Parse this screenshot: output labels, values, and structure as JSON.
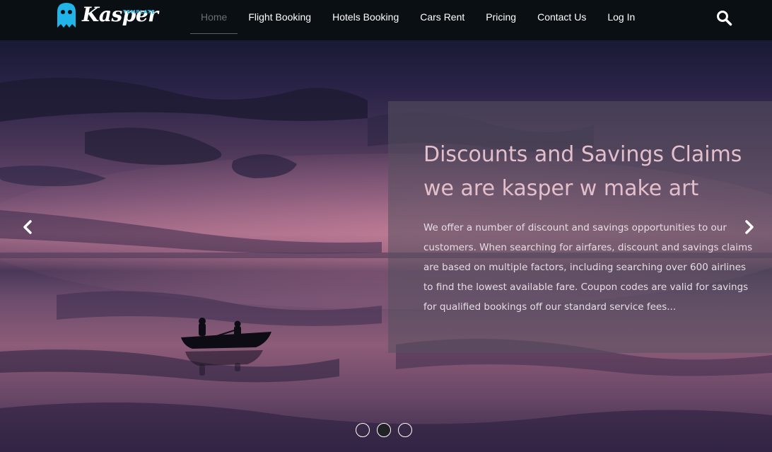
{
  "logo": {
    "wordmark": "Kasper",
    "tagline": "TEMPLATE",
    "ghost_icon": "ghost-icon",
    "accent": "#21b4e8"
  },
  "nav": {
    "items": [
      {
        "label": "Home",
        "active": true
      },
      {
        "label": "Flight Booking"
      },
      {
        "label": "Hotels Booking"
      },
      {
        "label": "Cars Rent"
      },
      {
        "label": "Pricing"
      },
      {
        "label": "Contact Us"
      },
      {
        "label": "Log In"
      }
    ],
    "search_icon": "search-icon"
  },
  "hero": {
    "title_line1": "Discounts and Savings Claims",
    "title_line2": "we are kasper w make art",
    "text": "We offer a number of discount and savings opportunities to our customers. When searching for airfares, discount and savings claims are based on multiple factors, including searching over 600 airlines to find the lowest available fare. Coupon codes are valid for savings for qualified bookings off our standard service fees...",
    "prev_icon": "chevron-left-icon",
    "next_icon": "chevron-right-icon",
    "indicators": {
      "count": 3,
      "active_index": 1
    }
  }
}
